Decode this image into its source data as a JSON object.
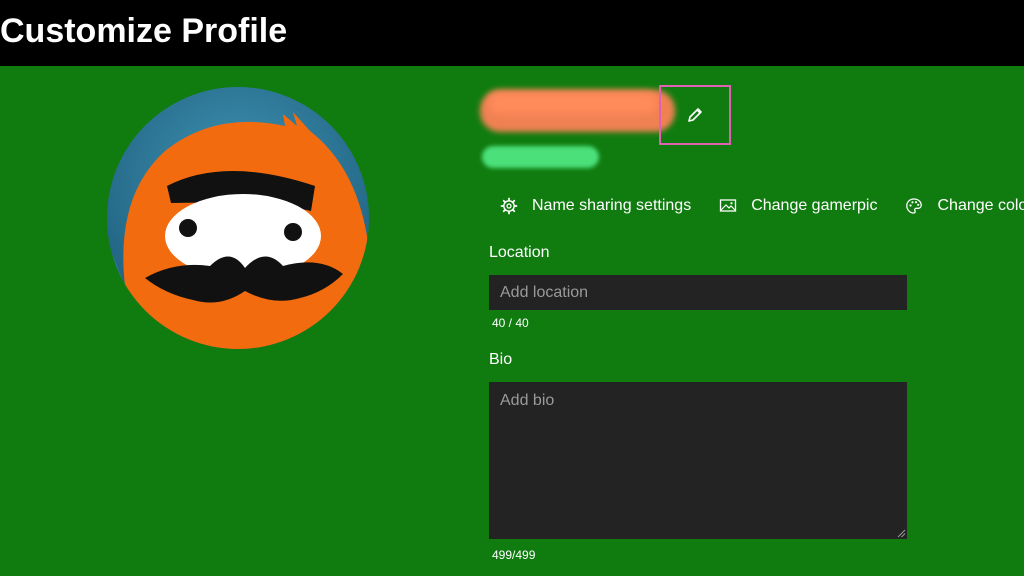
{
  "header": {
    "title": "Customize Profile"
  },
  "profile": {
    "avatar_icon": "gamerpic-avatar",
    "edit_name_icon": "pencil-icon"
  },
  "actions": [
    {
      "label": "Name sharing settings",
      "icon": "gear-icon"
    },
    {
      "label": "Change gamerpic",
      "icon": "picture-icon"
    },
    {
      "label": "Change color",
      "icon": "palette-icon"
    }
  ],
  "location": {
    "label": "Location",
    "placeholder": "Add location",
    "value": "",
    "counter": "40 / 40"
  },
  "bio": {
    "label": "Bio",
    "placeholder": "Add bio",
    "value": "",
    "counter": "499/499"
  },
  "colors": {
    "background": "#107c10",
    "header": "#000000",
    "input": "#232323",
    "focus_outline": "#e061b4",
    "avatar_orange": "#f26b0f",
    "avatar_blue": "#2f7e9c"
  }
}
